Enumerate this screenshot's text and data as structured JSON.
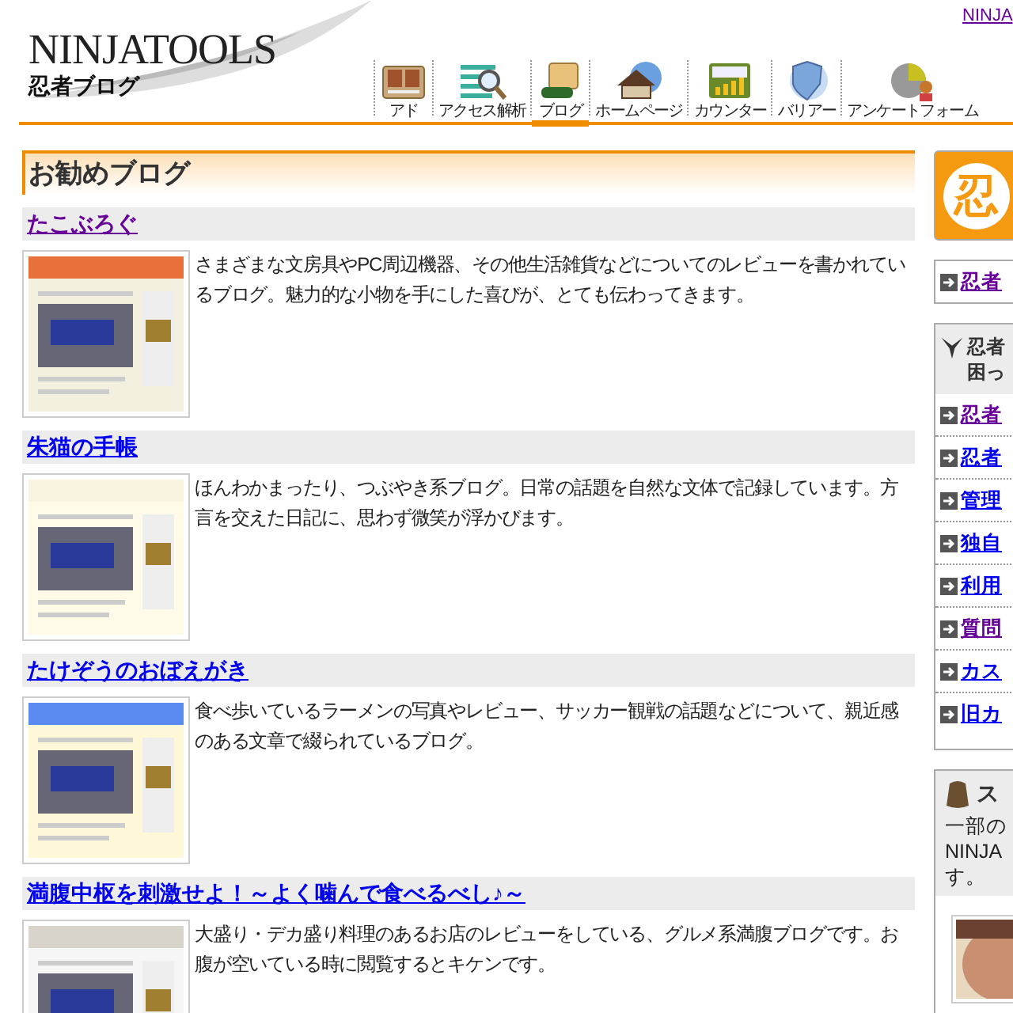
{
  "top_link": "NINJA",
  "logo": {
    "title": "NINJATOOLS",
    "subtitle": "忍者ブログ"
  },
  "nav": [
    {
      "label": "アド",
      "selected": false
    },
    {
      "label": "アクセス解析",
      "selected": false
    },
    {
      "label": "ブログ",
      "selected": true
    },
    {
      "label": "ホームページ",
      "selected": false
    },
    {
      "label": "カウンター",
      "selected": false
    },
    {
      "label": "バリアー",
      "selected": false
    },
    {
      "label": "アンケートフォーム",
      "selected": false
    }
  ],
  "section_title": "お勧めブログ",
  "blogs": [
    {
      "title": "たこぶろぐ",
      "visited": true,
      "description": "さまざまな文房具やPC周辺機器、その他生活雑貨などについてのレビューを書かれているブログ。魅力的な小物を手にした喜びが、とても伝わってきます。"
    },
    {
      "title": "朱猫の手帳",
      "visited": false,
      "description": "ほんわかまったり、つぶやき系ブログ。日常の話題を自然な文体で記録しています。方言を交えた日記に、思わず微笑が浮かびます。"
    },
    {
      "title": "たけぞうのおぼえがき",
      "visited": false,
      "description": "食べ歩いているラーメンの写真やレビュー、サッカー観戦の話題などについて、親近感のある文章で綴られているブログ。"
    },
    {
      "title": "満腹中枢を刺激せよ！～よく噛んで食べるべし♪～",
      "visited": false,
      "description": "大盛り・デカ盛り料理のあるお店のレビューをしている、グルメ系満腹ブログです。お腹が空いている時に閲覧するとキケンです。"
    }
  ],
  "sidebar": {
    "banner_mark": "忍",
    "top_link": {
      "label": "忍者",
      "visited": true
    },
    "help_box": {
      "title_lines": [
        "忍者",
        "困っ"
      ],
      "items": [
        {
          "label": "忍者",
          "visited": true
        },
        {
          "label": "忍者",
          "visited": false
        },
        {
          "label": "管理",
          "visited": false
        },
        {
          "label": "独自",
          "visited": false
        },
        {
          "label": "利用",
          "visited": false
        },
        {
          "label": "質問",
          "visited": true
        },
        {
          "label": "カス",
          "visited": false
        },
        {
          "label": "旧カ",
          "visited": false
        }
      ]
    },
    "staff_box": {
      "title": "ス",
      "text_lines": [
        "一部の",
        "NINJA",
        "す。"
      ]
    }
  }
}
